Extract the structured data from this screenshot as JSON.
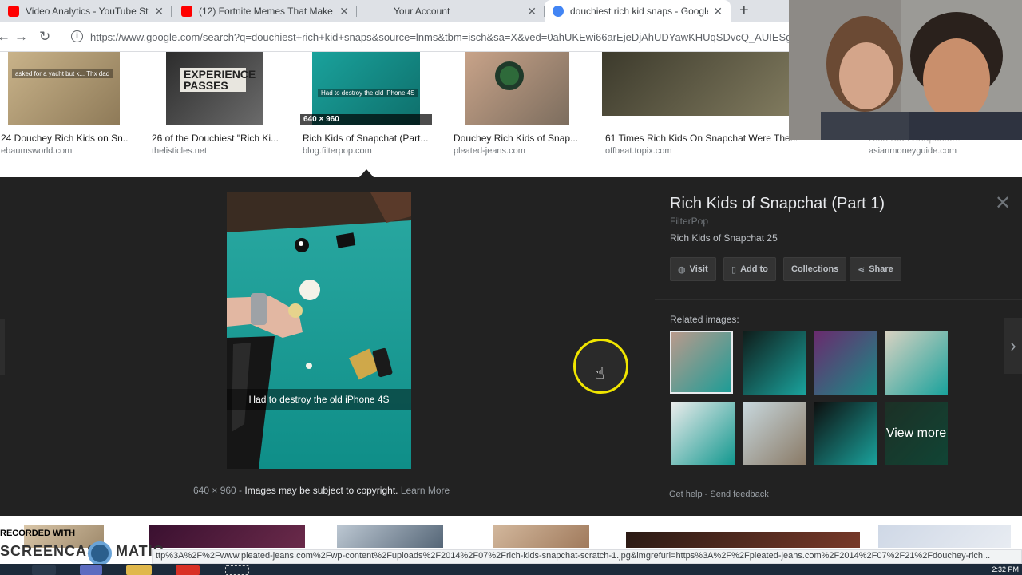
{
  "browser": {
    "tabs": [
      {
        "title": "Video Analytics - YouTube Studio",
        "favicon_color": "#ff0000",
        "active": false
      },
      {
        "title": "(12) Fortnite Memes That Make Me",
        "favicon_color": "#ff0000",
        "active": false
      },
      {
        "title": "Your Account",
        "favicon_color": "#dee1e6",
        "active": false
      },
      {
        "title": "douchiest rich kid snaps - Google",
        "favicon_color": "#4285f4",
        "active": true
      }
    ],
    "close_glyph": "✕",
    "new_tab_glyph": "+",
    "back_glyph": "←",
    "forward_glyph": "→",
    "reload_glyph": "↻",
    "info_glyph": "i",
    "url": "https://www.google.com/search?q=douchiest+rich+kid+snaps&source=lnms&tbm=isch&sa=X&ved=0ahUKEwi66arEjeDjAhUDYawKHUqSDvcQ_AUIESgB"
  },
  "results": [
    {
      "title": "24 Douchey Rich Kids on Sn...",
      "site": "ebaumsworld.com",
      "overlay": "asked for a yacht but k... Thx dad",
      "colors": [
        "#c9b38a",
        "#8e7a58"
      ]
    },
    {
      "title": "26 of the Douchiest \"Rich Ki...",
      "site": "thelisticles.net",
      "overlay": "EXPERIENCE PASSES",
      "colors": [
        "#2c2c2c",
        "#6b6b6b"
      ]
    },
    {
      "title": "Rich Kids of Snapchat (Part...",
      "site": "blog.filterpop.com",
      "overlay": "Had to destroy the old iPhone 4S",
      "dim": "640 × 960",
      "colors": [
        "#1aa29c",
        "#0e6f6b"
      ]
    },
    {
      "title": "Douchey Rich Kids of Snap...",
      "site": "pleated-jeans.com",
      "overlay": "",
      "colors": [
        "#c8a389",
        "#7c6d5e"
      ]
    },
    {
      "title": "61 Times Rich Kids On Snapchat Were The...",
      "site": "offbeat.topix.com",
      "overlay": "",
      "colors": [
        "#3c3a2c",
        "#807a5e"
      ]
    },
    {
      "title": "Rich Kids Snapchat...",
      "site": "asianmoneyguide.com",
      "overlay": "",
      "colors": [
        "#ffffff",
        "#ffffff"
      ]
    }
  ],
  "detail": {
    "title": "Rich Kids of Snapchat (Part 1)",
    "source": "FilterPop",
    "subtitle": "Rich Kids of Snapchat 25",
    "close_glyph": "✕",
    "next_glyph": "›",
    "actions": [
      {
        "label": "Visit",
        "icon": "globe-icon",
        "glyph": "◍"
      },
      {
        "label": "Add to",
        "icon": "bookmark-icon",
        "glyph": "▯"
      },
      {
        "label": "Collections",
        "icon": "",
        "glyph": ""
      },
      {
        "label": "Share",
        "icon": "share-icon",
        "glyph": "⋖"
      }
    ],
    "main_caption": "Had to destroy the old iPhone 4S",
    "meta_dims": "640 × 960",
    "meta_sep": " - ",
    "meta_copyright": "Images may be subject to copyright.",
    "meta_learn": "Learn More",
    "related_label": "Related images:",
    "related": [
      {
        "colors": [
          "#b99a8c",
          "#1d9c96"
        ],
        "selected": true
      },
      {
        "colors": [
          "#0f1c1a",
          "#1aa29c"
        ],
        "selected": false
      },
      {
        "colors": [
          "#6a2a6e",
          "#1a8c86"
        ],
        "selected": false
      },
      {
        "colors": [
          "#d9d2c2",
          "#1aa29c"
        ],
        "selected": false
      },
      {
        "colors": [
          "#ececec",
          "#12988f"
        ],
        "selected": false
      },
      {
        "colors": [
          "#c8d8de",
          "#8a7a66"
        ],
        "selected": false
      },
      {
        "colors": [
          "#0d0d0d",
          "#1aa29c"
        ],
        "selected": false
      },
      {
        "colors": [
          "#2c4a3a",
          "#1a6a52"
        ],
        "selected": false
      }
    ],
    "view_more": "View more",
    "help": "Get help",
    "feedback": "Send feedback",
    "dot": " - "
  },
  "bottom_thumbs": [
    {
      "colors": [
        "#d9c6a8",
        "#9f8a6c"
      ]
    },
    {
      "colors": [
        "#3a1030",
        "#6a2a4a"
      ]
    },
    {
      "colors": [
        "#bcc7d2",
        "#556677"
      ]
    },
    {
      "colors": [
        "#d2b79c",
        "#a07a5c"
      ]
    },
    {
      "colors": [
        "#2a1a14",
        "#7a3a2a"
      ]
    },
    {
      "colors": [
        "#cfd8e6",
        "#e8ecf2"
      ]
    }
  ],
  "watermark": {
    "line1": "RECORDED WITH",
    "line2": "SCREENCAST",
    "line3": "MATIC"
  },
  "status_url": "ttp%3A%2F%2Fwww.pleated-jeans.com%2Fwp-content%2Fuploads%2F2014%2F07%2Frich-kids-snapchat-scratch-1.jpg&imgrefurl=https%3A%2F%2Fpleated-jeans.com%2F2014%2F07%2F21%2Fdouchey-rich...",
  "clock": "2:32 PM"
}
